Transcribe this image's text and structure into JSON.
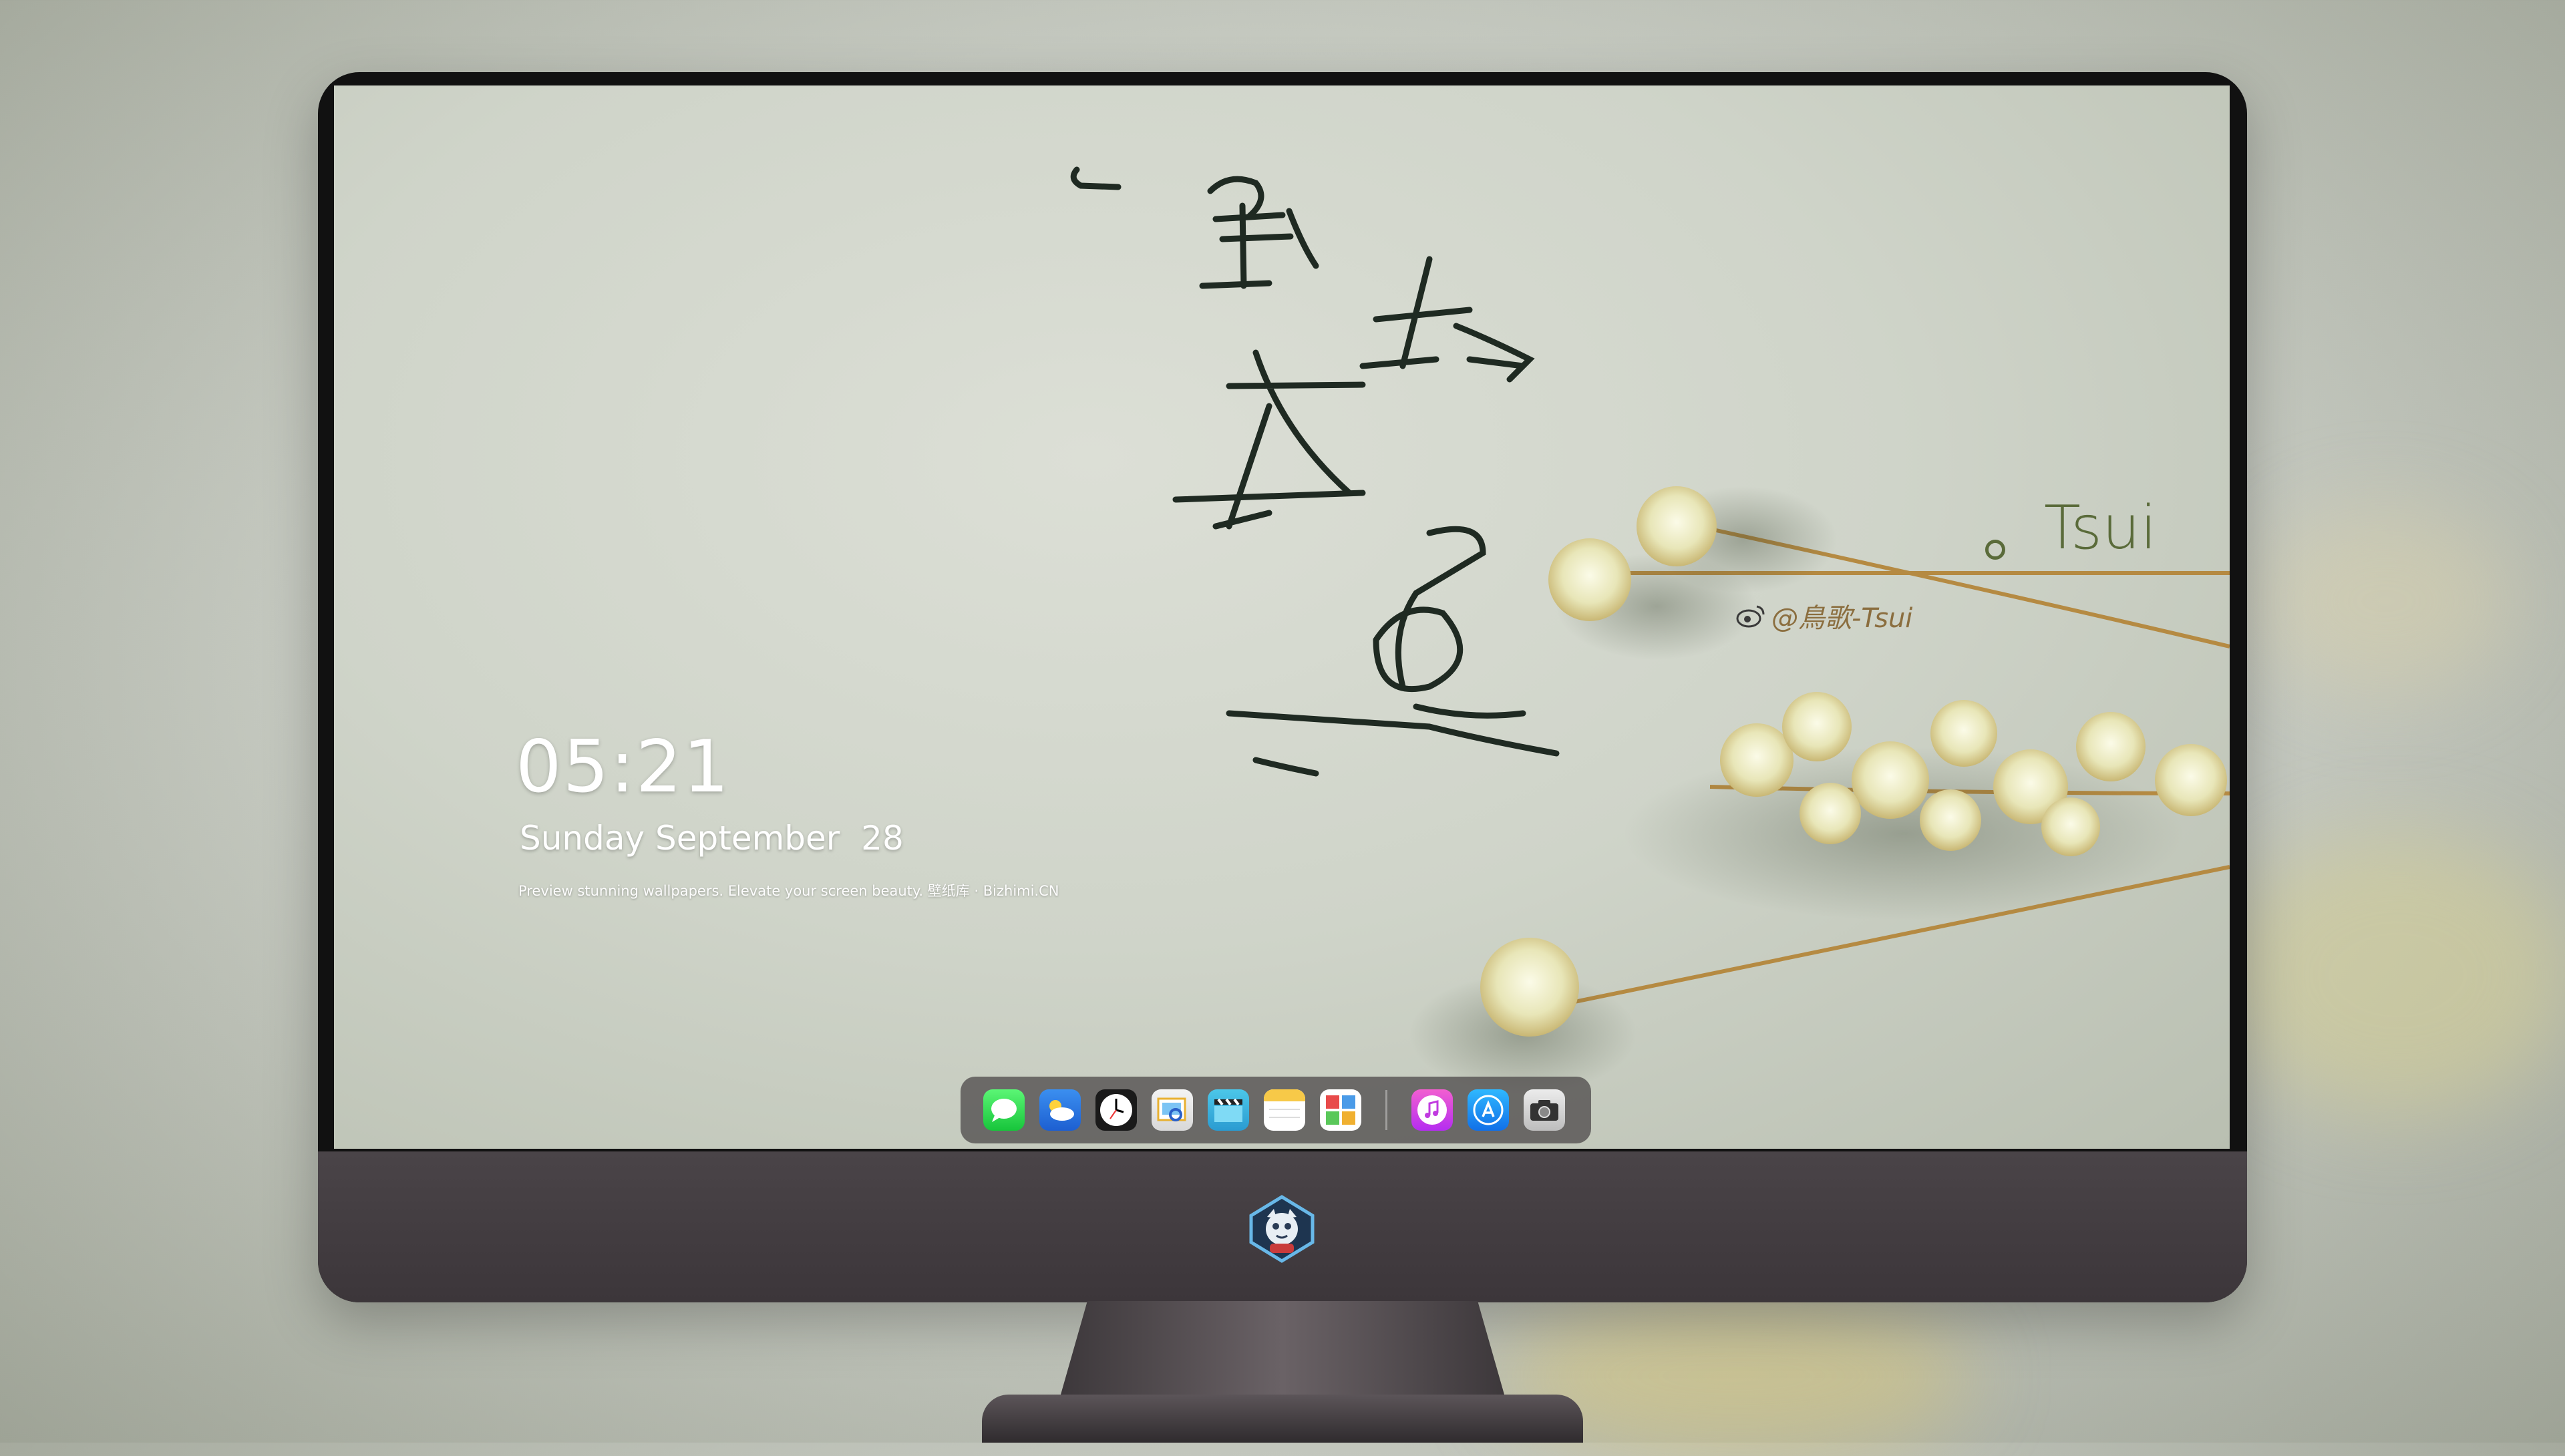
{
  "lockscreen": {
    "time": "05:21",
    "date": "Sunday September  28",
    "tagline": "Preview stunning wallpapers. Elevate your screen beauty. 壁纸库 · Bizhimi.CN"
  },
  "wallpaper": {
    "signature": "Tsui",
    "weibo_handle": "@鳥歌-Tsui"
  },
  "dock": {
    "apps": [
      {
        "name": "Messages",
        "icon": "messages-icon"
      },
      {
        "name": "Weather",
        "icon": "weather-icon"
      },
      {
        "name": "Clock",
        "icon": "clock-icon"
      },
      {
        "name": "Preview",
        "icon": "preview-icon"
      },
      {
        "name": "Clips",
        "icon": "clapperboard-icon"
      },
      {
        "name": "Notes",
        "icon": "notes-icon"
      },
      {
        "name": "Photo Booth",
        "icon": "photo-collage-icon"
      },
      {
        "name": "Music",
        "icon": "music-icon"
      },
      {
        "name": "App Store",
        "icon": "app-store-icon"
      },
      {
        "name": "Camera",
        "icon": "camera-icon"
      }
    ]
  },
  "colors": {
    "bezel": "#111111",
    "chin": "#433d41",
    "wallpaper": "#d2d6cc",
    "signature": "#5a6b3a"
  }
}
